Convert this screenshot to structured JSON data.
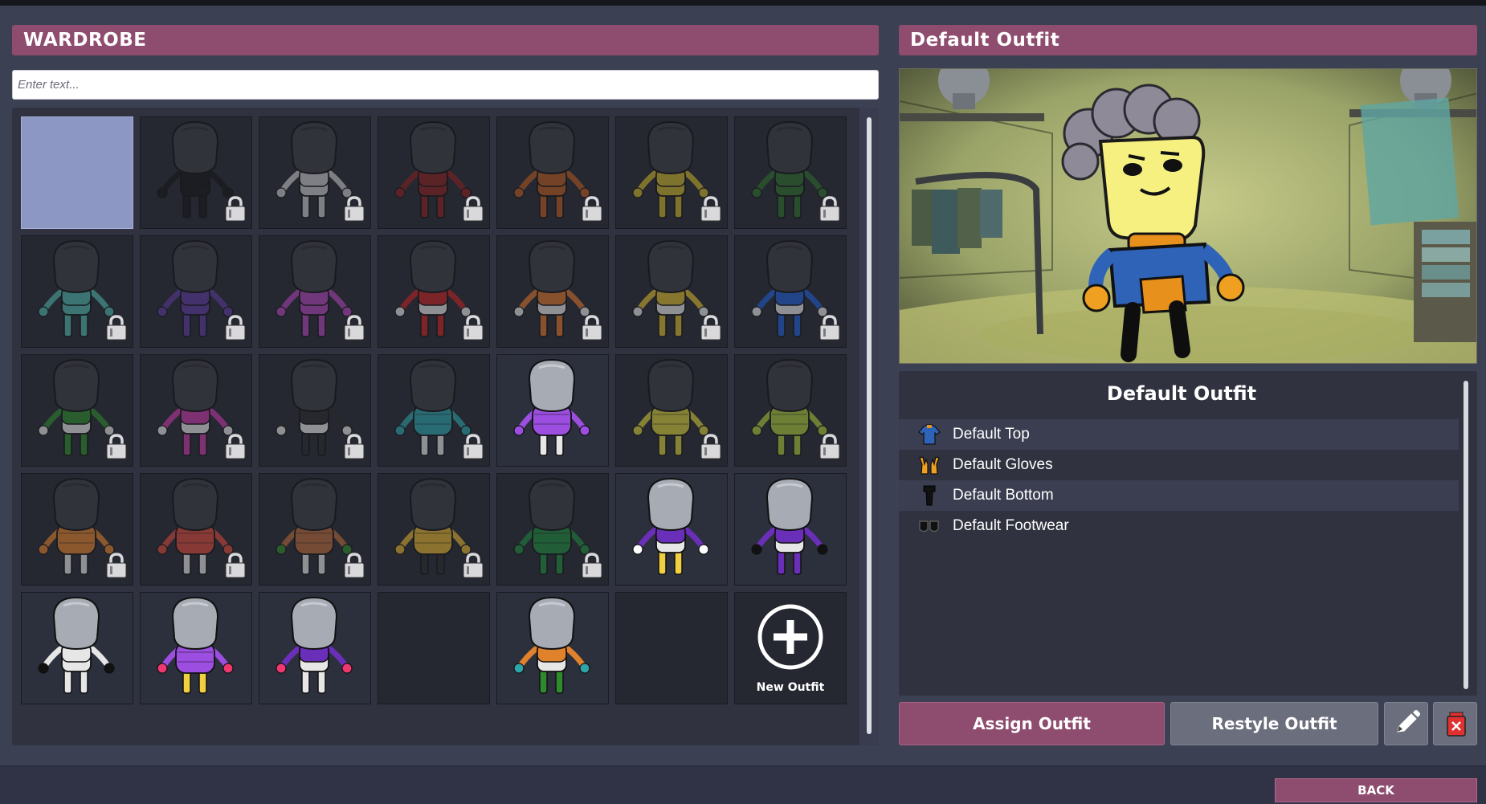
{
  "wardrobe": {
    "title": "WARDROBE",
    "search_placeholder": "Enter text...",
    "new_outfit_label": "New Outfit",
    "tiles": [
      {
        "kind": "selected-empty"
      },
      {
        "kind": "dupe",
        "body": "#161616",
        "top": "#161616",
        "hands": "#161616",
        "legs": "#161616",
        "locked": true
      },
      {
        "kind": "dupe",
        "body": "#c8c8c8",
        "top": "#c8c8c8",
        "hands": "#c8c8c8",
        "legs": "#c8c8c8",
        "locked": true
      },
      {
        "kind": "dupe",
        "body": "#8a2020",
        "top": "#8a2020",
        "hands": "#8a2020",
        "legs": "#8a2020",
        "locked": true
      },
      {
        "kind": "dupe",
        "body": "#b65a20",
        "top": "#b65a20",
        "hands": "#b65a20",
        "legs": "#b65a20",
        "locked": true
      },
      {
        "kind": "dupe",
        "body": "#c8b22a",
        "top": "#c8b22a",
        "hands": "#c8b22a",
        "legs": "#c8b22a",
        "locked": true
      },
      {
        "kind": "dupe",
        "body": "#2f6c2c",
        "top": "#2f6c2c",
        "hands": "#2f6c2c",
        "legs": "#2f6c2c",
        "locked": true
      },
      {
        "kind": "dupe",
        "body": "#4db3a8",
        "top": "#4db3a8",
        "hands": "#4db3a8",
        "legs": "#4db3a8",
        "locked": true
      },
      {
        "kind": "dupe",
        "body": "#5a3a9c",
        "top": "#5a3a9c",
        "hands": "#5a3a9c",
        "legs": "#5a3a9c",
        "locked": true
      },
      {
        "kind": "dupe",
        "body": "#b045b8",
        "top": "#b045b8",
        "hands": "#b045b8",
        "legs": "#b045b8",
        "locked": true
      },
      {
        "kind": "dupe",
        "body": "#e6e6e6",
        "top": "#c22424",
        "hands": "#e6e6e6",
        "legs": "#c22424",
        "locked": true
      },
      {
        "kind": "dupe",
        "body": "#e6e6e6",
        "top": "#d8742c",
        "hands": "#e6e6e6",
        "legs": "#d8742c",
        "locked": true
      },
      {
        "kind": "dupe",
        "body": "#e6e6e6",
        "top": "#d8b82c",
        "hands": "#e6e6e6",
        "legs": "#d8b82c",
        "locked": true
      },
      {
        "kind": "dupe",
        "body": "#e6e6e6",
        "top": "#1f5fd0",
        "hands": "#e6e6e6",
        "legs": "#1f5fd0",
        "locked": true
      },
      {
        "kind": "dupe",
        "body": "#e6e6e6",
        "top": "#2e8a2c",
        "hands": "#e6e6e6",
        "legs": "#2e8a2c",
        "locked": true
      },
      {
        "kind": "dupe",
        "body": "#e6e6e6",
        "top": "#c83aa8",
        "hands": "#e6e6e6",
        "legs": "#c83aa8",
        "locked": true
      },
      {
        "kind": "dupe",
        "body": "#e6e6e6",
        "top": "#2a2a2a",
        "hands": "#e6e6e6",
        "legs": "#2a2a2a",
        "locked": true
      },
      {
        "kind": "dupe",
        "body": "#2ea3a8",
        "top": "#2ea3a8",
        "hands": "#2ea3a8",
        "legs": "#e6e6e6",
        "locked": true,
        "puffy": true
      },
      {
        "kind": "dupe",
        "body": "#9b4ee0",
        "top": "#9b4ee0",
        "hands": "#9b4ee0",
        "legs": "#e6e6e6",
        "locked": false,
        "puffy": true
      },
      {
        "kind": "dupe",
        "body": "#d4cc3a",
        "top": "#d4cc3a",
        "hands": "#d4cc3a",
        "legs": "#d4cc3a",
        "locked": true,
        "puffy": true
      },
      {
        "kind": "dupe",
        "body": "#a8c83a",
        "top": "#a8c83a",
        "hands": "#a8c83a",
        "legs": "#a8c83a",
        "locked": true,
        "puffy": true
      },
      {
        "kind": "dupe",
        "body": "#e0812c",
        "top": "#e0812c",
        "hands": "#e0812c",
        "legs": "#e6e6e6",
        "locked": true,
        "puffy": true
      },
      {
        "kind": "dupe",
        "body": "#d84a3a",
        "top": "#d84a3a",
        "hands": "#d84a3a",
        "legs": "#e6e6e6",
        "locked": true,
        "puffy": true
      },
      {
        "kind": "dupe",
        "body": "#b86a3a",
        "top": "#b86a3a",
        "hands": "#2e8a2c",
        "legs": "#e6e6e6",
        "locked": true,
        "puffy": true
      },
      {
        "kind": "dupe",
        "body": "#e0b02c",
        "top": "#e0b02c",
        "hands": "#e0b02c",
        "legs": "#2a2a2a",
        "locked": true,
        "puffy": true
      },
      {
        "kind": "dupe",
        "body": "#1e8a3c",
        "top": "#1e8a3c",
        "hands": "#1e8a3c",
        "legs": "#1e8a3c",
        "locked": true,
        "puffy": true
      },
      {
        "kind": "dupe",
        "body": "#e6e6e6",
        "top": "#6a2fb8",
        "hands": "#ffffff",
        "legs": "#f0d040",
        "locked": false
      },
      {
        "kind": "dupe",
        "body": "#e6e6e6",
        "top": "#6a2fb8",
        "hands": "#111111",
        "legs": "#6a2fb8",
        "locked": false
      },
      {
        "kind": "dupe",
        "body": "#e6e6e6",
        "top": "#e6e6e6",
        "hands": "#111111",
        "legs": "#e6e6e6",
        "locked": false
      },
      {
        "kind": "dupe",
        "body": "#9b4ee0",
        "top": "#9b4ee0",
        "hands": "#f03870",
        "legs": "#f0d040",
        "locked": false,
        "puffy": true
      },
      {
        "kind": "dupe",
        "body": "#e6e6e6",
        "top": "#6a2fb8",
        "hands": "#f03870",
        "legs": "#e6e6e6",
        "locked": false
      },
      {
        "kind": "empty"
      },
      {
        "kind": "dupe",
        "body": "#e6e6e6",
        "top": "#e0812c",
        "hands": "#2ea3a8",
        "legs": "#2e8a2c",
        "locked": false
      },
      {
        "kind": "empty"
      },
      {
        "kind": "new-outfit"
      }
    ]
  },
  "outfit": {
    "title": "Default Outfit",
    "details_title": "Default Outfit",
    "items": [
      {
        "label": "Default Top",
        "icon": "shirt-icon"
      },
      {
        "label": "Default Gloves",
        "icon": "gloves-icon"
      },
      {
        "label": "Default Bottom",
        "icon": "pants-icon"
      },
      {
        "label": "Default Footwear",
        "icon": "shoes-icon"
      }
    ]
  },
  "buttons": {
    "assign": "Assign Outfit",
    "restyle": "Restyle Outfit",
    "back": "BACK"
  },
  "colors": {
    "accent": "#8e4c6e",
    "panel": "#30333f",
    "background": "#3c4053",
    "selected_tile": "#8c97c4"
  }
}
